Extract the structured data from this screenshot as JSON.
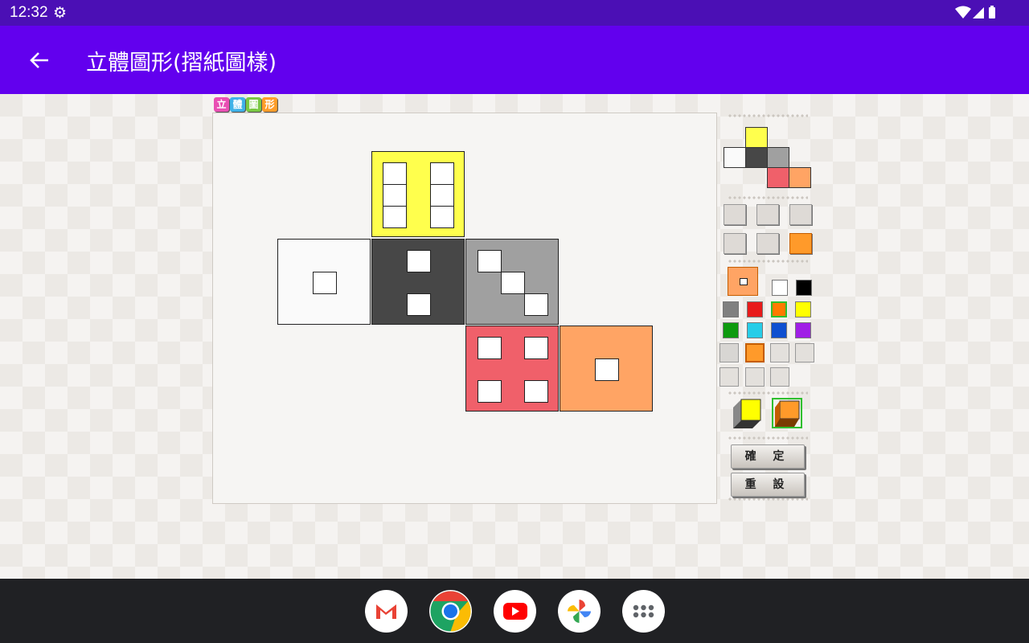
{
  "status": {
    "time": "12:32"
  },
  "app_bar": {
    "title": "立體圖形(摺紙圖樣)"
  },
  "logo": {
    "chars": [
      "立",
      "體",
      "圖",
      "形"
    ]
  },
  "colors": {
    "app_bar": "#6200ee",
    "status_bar": "#4b0fb5",
    "faces": [
      "#ffff4d",
      "#fafafa",
      "#474747",
      "#a0a0a0",
      "#f0606a",
      "#ffa464"
    ]
  },
  "swatch_colors": [
    "#ffffff",
    "#000000",
    "#808080",
    "#e81b1b",
    "#ff7a00",
    "#ffff00",
    "#0e9a0e",
    "#27cde8",
    "#0f4fd0",
    "#a01fe6"
  ],
  "buttons": {
    "confirm": "確 定",
    "reset": "重 設"
  },
  "dock": [
    "Gmail",
    "Chrome",
    "YouTube",
    "Photos",
    "Apps"
  ]
}
